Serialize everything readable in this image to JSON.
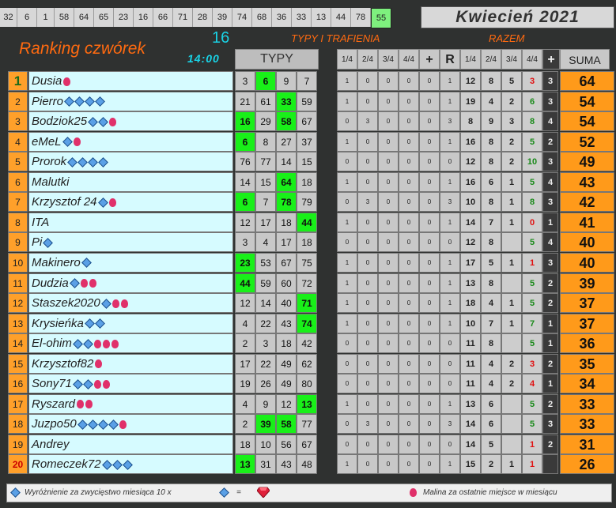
{
  "topbar": {
    "numbers": [
      "32",
      "6",
      "1",
      "58",
      "64",
      "65",
      "23",
      "16",
      "66",
      "71",
      "28",
      "39",
      "74",
      "68",
      "36",
      "33",
      "13",
      "44",
      "78",
      "55"
    ],
    "highlight_index": 19
  },
  "month": "Kwiecień 2021",
  "title": "Ranking czwórek",
  "round_number": "16",
  "time": "14:00",
  "typy_trafienia": "TYPY I TRAFIENIA",
  "razem": "RAZEM",
  "typy_header": "TYPY",
  "hdr": [
    "1/4",
    "2/4",
    "3/4",
    "4/4",
    "+",
    "R",
    "1/4",
    "2/4",
    "3/4",
    "4/4",
    "+",
    "SUMA"
  ],
  "rows": [
    {
      "rank": "1",
      "name": "Dusia",
      "dia": 0,
      "mal": 1,
      "typy": [
        "3",
        "6",
        "9",
        "7"
      ],
      "typy_hl": [
        1
      ],
      "stats": [
        "1",
        "0",
        "0",
        "0",
        "0",
        "1"
      ],
      "razem": [
        "12",
        "8",
        "5",
        "3"
      ],
      "razem_color": [
        "",
        "",
        "",
        "red"
      ],
      "plus": "3",
      "suma": "64"
    },
    {
      "rank": "2",
      "name": "Pierro",
      "dia": 4,
      "mal": 0,
      "typy": [
        "21",
        "61",
        "33",
        "59"
      ],
      "typy_hl": [
        2
      ],
      "stats": [
        "1",
        "0",
        "0",
        "0",
        "0",
        "1"
      ],
      "razem": [
        "19",
        "4",
        "2",
        "6"
      ],
      "razem_color": [
        "",
        "",
        "",
        "green"
      ],
      "plus": "3",
      "suma": "54"
    },
    {
      "rank": "3",
      "name": "Bodziok25",
      "dia": 2,
      "mal": 1,
      "mal_first": true,
      "typy": [
        "16",
        "29",
        "58",
        "67"
      ],
      "typy_hl": [
        0,
        2
      ],
      "stats": [
        "0",
        "3",
        "0",
        "0",
        "0",
        "3"
      ],
      "razem": [
        "8",
        "9",
        "3",
        "8"
      ],
      "razem_color": [
        "",
        "",
        "",
        "green"
      ],
      "plus": "4",
      "suma": "54"
    },
    {
      "rank": "4",
      "name": "eMeL",
      "dia": 1,
      "mal": 1,
      "typy": [
        "6",
        "8",
        "27",
        "37"
      ],
      "typy_hl": [
        0
      ],
      "stats": [
        "1",
        "0",
        "0",
        "0",
        "0",
        "1"
      ],
      "razem": [
        "16",
        "8",
        "2",
        "5"
      ],
      "razem_color": [
        "",
        "",
        "",
        "green"
      ],
      "plus": "2",
      "suma": "52"
    },
    {
      "rank": "5",
      "name": "Prorok",
      "dia": 4,
      "mal": 0,
      "typy": [
        "76",
        "77",
        "14",
        "15"
      ],
      "typy_hl": [],
      "stats": [
        "0",
        "0",
        "0",
        "0",
        "0",
        "0"
      ],
      "razem": [
        "12",
        "8",
        "2",
        "10"
      ],
      "razem_color": [
        "",
        "",
        "",
        "green"
      ],
      "plus": "3",
      "suma": "49"
    },
    {
      "rank": "6",
      "name": "Malutki",
      "dia": 0,
      "mal": 0,
      "typy": [
        "14",
        "15",
        "64",
        "18"
      ],
      "typy_hl": [
        2
      ],
      "stats": [
        "1",
        "0",
        "0",
        "0",
        "0",
        "1"
      ],
      "razem": [
        "16",
        "6",
        "1",
        "5"
      ],
      "razem_color": [
        "",
        "",
        "",
        "green"
      ],
      "plus": "4",
      "suma": "43"
    },
    {
      "rank": "7",
      "name": "Krzysztof 24",
      "dia": 1,
      "mal": 1,
      "typy": [
        "6",
        "7",
        "78",
        "79"
      ],
      "typy_hl": [
        0,
        2
      ],
      "stats": [
        "0",
        "3",
        "0",
        "0",
        "0",
        "3"
      ],
      "razem": [
        "10",
        "8",
        "1",
        "8"
      ],
      "razem_color": [
        "",
        "",
        "",
        "green"
      ],
      "plus": "3",
      "suma": "42"
    },
    {
      "rank": "8",
      "name": "ITA",
      "dia": 0,
      "mal": 0,
      "typy": [
        "12",
        "17",
        "18",
        "44"
      ],
      "typy_hl": [
        3
      ],
      "stats": [
        "1",
        "0",
        "0",
        "0",
        "0",
        "1"
      ],
      "razem": [
        "14",
        "7",
        "1",
        "0"
      ],
      "razem_color": [
        "",
        "",
        "",
        "red"
      ],
      "plus": "1",
      "suma": "41"
    },
    {
      "rank": "9",
      "name": "Pi",
      "dia": 1,
      "mal": 0,
      "typy": [
        "3",
        "4",
        "17",
        "18"
      ],
      "typy_hl": [],
      "stats": [
        "0",
        "0",
        "0",
        "0",
        "0",
        "0"
      ],
      "razem": [
        "12",
        "8",
        "",
        "5"
      ],
      "razem_color": [
        "",
        "",
        "",
        "green"
      ],
      "plus": "4",
      "suma": "40"
    },
    {
      "rank": "10",
      "name": "Makinero",
      "dia": 1,
      "mal": 0,
      "typy": [
        "23",
        "53",
        "67",
        "75"
      ],
      "typy_hl": [
        0
      ],
      "stats": [
        "1",
        "0",
        "0",
        "0",
        "0",
        "1"
      ],
      "razem": [
        "17",
        "5",
        "1",
        "1"
      ],
      "razem_color": [
        "",
        "",
        "",
        "red"
      ],
      "plus": "3",
      "suma": "40"
    },
    {
      "rank": "11",
      "name": "Dudzia",
      "dia": 1,
      "mal": 2,
      "typy": [
        "44",
        "59",
        "60",
        "72"
      ],
      "typy_hl": [
        0
      ],
      "stats": [
        "1",
        "0",
        "0",
        "0",
        "0",
        "1"
      ],
      "razem": [
        "13",
        "8",
        "",
        "5"
      ],
      "razem_color": [
        "",
        "",
        "",
        "green"
      ],
      "plus": "2",
      "suma": "39"
    },
    {
      "rank": "12",
      "name": "Staszek2020",
      "dia": 1,
      "mal": 2,
      "typy": [
        "12",
        "14",
        "40",
        "71"
      ],
      "typy_hl": [
        3
      ],
      "stats": [
        "1",
        "0",
        "0",
        "0",
        "0",
        "1"
      ],
      "razem": [
        "18",
        "4",
        "1",
        "5"
      ],
      "razem_color": [
        "",
        "",
        "",
        "green"
      ],
      "plus": "2",
      "suma": "37"
    },
    {
      "rank": "13",
      "name": "Krysieńka",
      "dia": 2,
      "mal": 0,
      "typy": [
        "4",
        "22",
        "43",
        "74"
      ],
      "typy_hl": [
        3
      ],
      "stats": [
        "1",
        "0",
        "0",
        "0",
        "0",
        "1"
      ],
      "razem": [
        "10",
        "7",
        "1",
        "7"
      ],
      "razem_color": [
        "",
        "",
        "",
        "green"
      ],
      "plus": "1",
      "suma": "37"
    },
    {
      "rank": "14",
      "name": "El-ohim",
      "dia": 2,
      "mal": 3,
      "typy": [
        "2",
        "3",
        "18",
        "42"
      ],
      "typy_hl": [],
      "stats": [
        "0",
        "0",
        "0",
        "0",
        "0",
        "0"
      ],
      "razem": [
        "11",
        "8",
        "",
        "5"
      ],
      "razem_color": [
        "",
        "",
        "",
        "green"
      ],
      "plus": "1",
      "suma": "36"
    },
    {
      "rank": "15",
      "name": "Krzysztof82",
      "dia": 0,
      "mal": 1,
      "typy": [
        "17",
        "22",
        "49",
        "62"
      ],
      "typy_hl": [],
      "stats": [
        "0",
        "0",
        "0",
        "0",
        "0",
        "0"
      ],
      "razem": [
        "11",
        "4",
        "2",
        "3"
      ],
      "razem_color": [
        "",
        "",
        "",
        "red"
      ],
      "plus": "2",
      "suma": "35"
    },
    {
      "rank": "16",
      "name": "Sony71",
      "dia": 2,
      "mal": 2,
      "typy": [
        "19",
        "26",
        "49",
        "80"
      ],
      "typy_hl": [],
      "stats": [
        "0",
        "0",
        "0",
        "0",
        "0",
        "0"
      ],
      "razem": [
        "11",
        "4",
        "2",
        "4"
      ],
      "razem_color": [
        "",
        "",
        "",
        "red"
      ],
      "plus": "1",
      "suma": "34"
    },
    {
      "rank": "17",
      "name": "Ryszard",
      "dia": 0,
      "mal": 2,
      "typy": [
        "4",
        "9",
        "12",
        "13"
      ],
      "typy_hl": [
        3
      ],
      "stats": [
        "1",
        "0",
        "0",
        "0",
        "0",
        "1"
      ],
      "razem": [
        "13",
        "6",
        "",
        "5"
      ],
      "razem_color": [
        "",
        "",
        "",
        "green"
      ],
      "plus": "2",
      "suma": "33"
    },
    {
      "rank": "18",
      "name": "Juzpo50",
      "dia": 4,
      "mal": 1,
      "typy": [
        "2",
        "39",
        "58",
        "77"
      ],
      "typy_hl": [
        1,
        2
      ],
      "stats": [
        "0",
        "3",
        "0",
        "0",
        "0",
        "3"
      ],
      "razem": [
        "14",
        "6",
        "",
        "5"
      ],
      "razem_color": [
        "",
        "",
        "",
        "green"
      ],
      "plus": "3",
      "suma": "33"
    },
    {
      "rank": "19",
      "name": "Andrey",
      "dia": 0,
      "mal": 0,
      "typy": [
        "18",
        "10",
        "56",
        "67"
      ],
      "typy_hl": [],
      "stats": [
        "0",
        "0",
        "0",
        "0",
        "0",
        "0"
      ],
      "razem": [
        "14",
        "5",
        "",
        "1"
      ],
      "razem_color": [
        "",
        "",
        "",
        "red"
      ],
      "plus": "2",
      "suma": "31"
    },
    {
      "rank": "20",
      "name": "Romeczek72",
      "dia": 3,
      "mal": 0,
      "typy": [
        "13",
        "31",
        "43",
        "48"
      ],
      "typy_hl": [
        0
      ],
      "stats": [
        "1",
        "0",
        "0",
        "0",
        "0",
        "1"
      ],
      "razem": [
        "15",
        "2",
        "1",
        "1"
      ],
      "razem_color": [
        "",
        "",
        "",
        "red"
      ],
      "plus": "",
      "suma": "26"
    }
  ],
  "footer": {
    "left": "Wyróżnienie za zwycięstwo miesiąca  10 x",
    "eq": "=",
    "right": "Malina za ostatnie miejsce w miesiącu"
  },
  "colors": {
    "accent": "#ff6a10",
    "cyan": "#19d3e6",
    "hit": "#19f019",
    "rank_bg": "#ffa02a",
    "suma_bg": "#ff9a1a"
  }
}
